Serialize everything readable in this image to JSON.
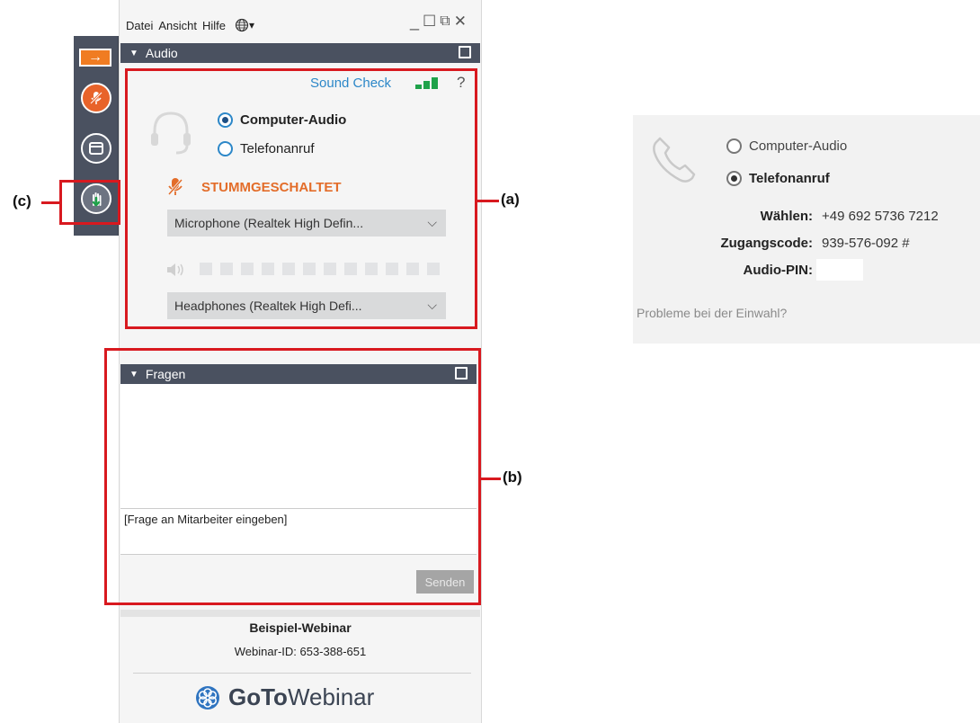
{
  "menu": {
    "datei": "Datei",
    "ansicht": "Ansicht",
    "hilfe": "Hilfe",
    "language_arrow": "▾"
  },
  "window_controls": {
    "minimize": "_",
    "maximize": "☐",
    "popout": "⧉",
    "close": "✕"
  },
  "audio": {
    "title": "Audio",
    "sound_check": "Sound Check",
    "help": "?",
    "option_computer": "Computer-Audio",
    "option_phone": "Telefonanruf",
    "selected": "Computer-Audio",
    "muted_label": "STUMMGESCHALTET",
    "microphone_value": "Microphone (Realtek  High Defin...",
    "speaker_value": "Headphones (Realtek  High Defi...",
    "signal_strength_bars": 3,
    "speaker_level_segments": 12
  },
  "questions": {
    "title": "Fragen",
    "input_placeholder": "[Frage an Mitarbeiter eingeben]",
    "send_button": "Senden"
  },
  "footer": {
    "webinar_name": "Beispiel-Webinar",
    "webinar_id": "Webinar-ID: 653-388-651",
    "logo_bold": "GoTo",
    "logo_light": "Webinar"
  },
  "annotations": {
    "a": "(a)",
    "b": "(b)",
    "c": "(c)"
  },
  "phone_dialog": {
    "option_computer": "Computer-Audio",
    "option_phone": "Telefonanruf",
    "selected": "Telefonanruf",
    "dial_label": "Wählen:",
    "dial_value": "+49 692 5736 7212",
    "access_label": "Zugangscode:",
    "access_value": "939-576-092 #",
    "pin_label": "Audio-PIN:",
    "pin_value": "",
    "problems_link": "Probleme bei der Einwahl?"
  },
  "colors": {
    "header_bar": "#4a5160",
    "accent_blue": "#2c87c8",
    "muted_orange": "#e36d2a",
    "signal_green": "#1fa24a",
    "annotation_red": "#d8191f"
  },
  "icons": {
    "toolbar": [
      "arrow-right-icon",
      "microphone-muted-icon",
      "window-icon",
      "raise-hand-icon"
    ],
    "audio": [
      "headset-icon",
      "microphone-muted-icon",
      "speaker-icon",
      "signal-bars-icon"
    ],
    "dialog": [
      "phone-handset-icon"
    ],
    "menu": [
      "globe-icon"
    ],
    "logo": [
      "gotowebinar-flower-icon"
    ]
  }
}
